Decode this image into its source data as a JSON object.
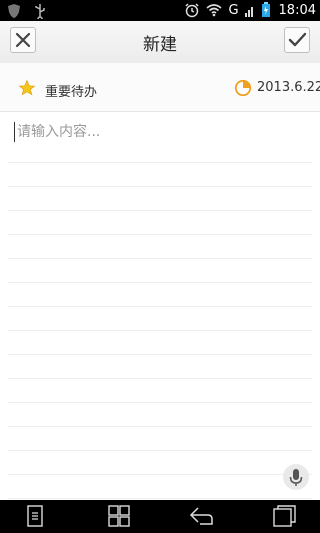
{
  "status_bar": {
    "time": "18:04",
    "network_label": "G",
    "icons": [
      "shield-icon",
      "usb-icon",
      "alarm-icon",
      "wifi-icon",
      "signal-icon",
      "battery-icon"
    ]
  },
  "header": {
    "title": "新建",
    "left_icon": "close-icon",
    "right_icon": "check-icon"
  },
  "info": {
    "important_label": "重要待办",
    "date": "2013.6.22",
    "star_color": "#f5c518",
    "clock_color": "#f0a020"
  },
  "editor": {
    "placeholder": "请输入内容..."
  },
  "nav_bar": {
    "icons": [
      "menu-icon",
      "apps-icon",
      "back-icon",
      "recent-apps-icon"
    ]
  }
}
